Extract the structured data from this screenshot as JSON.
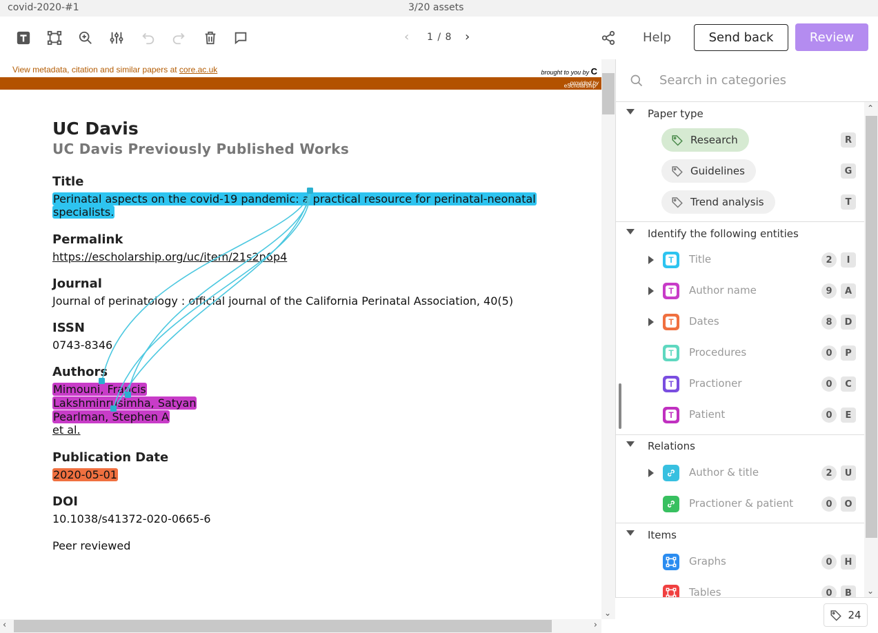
{
  "topbar": {
    "doc_name": "covid-2020-#1",
    "assets": "3/20 assets"
  },
  "toolbar": {
    "page": "1 / 8",
    "help": "Help",
    "send_back": "Send back",
    "review": "Review",
    "review_color": "#b48cf0"
  },
  "document": {
    "core_meta_prefix": "View metadata, citation and similar papers at ",
    "core_meta_link": "core.ac.uk",
    "brought_to_you": "brought to you by",
    "brought_logo": "C",
    "provided_by_label": "provided by",
    "provided_by_text": "eScholarship - University of Ca",
    "institution": "UC Davis",
    "collection": "UC Davis Previously Published Works",
    "title_label": "Title",
    "title_line1": "Perinatal aspects on the covid-19 pandemic: a practical resource for perinatal-neonatal",
    "title_line2": "specialists.",
    "permalink_label": "Permalink",
    "permalink": "https://escholarship.org/uc/item/21s2n6p4",
    "journal_label": "Journal",
    "journal": "Journal of perinatology : official journal of the California Perinatal Association, 40(5)",
    "issn_label": "ISSN",
    "issn": "0743-8346",
    "authors_label": "Authors",
    "authors": [
      "Mimouni, Francis",
      "Lakshminrusimha, Satyan",
      "Pearlman, Stephen A"
    ],
    "et_al": "et al.",
    "pubdate_label": "Publication Date",
    "pubdate": "2020-05-01",
    "doi_label": "DOI",
    "doi": "10.1038/s41372-020-0665-6",
    "peer_reviewed": "Peer reviewed"
  },
  "panel": {
    "search_placeholder": "Search in categories",
    "paper_type": {
      "header": "Paper type",
      "items": [
        {
          "label": "Research",
          "key": "R",
          "active": true
        },
        {
          "label": "Guidelines",
          "key": "G",
          "active": false
        },
        {
          "label": "Trend analysis",
          "key": "T",
          "active": false
        }
      ]
    },
    "entities": {
      "header": "Identify the following entities",
      "items": [
        {
          "label": "Title",
          "count": "2",
          "key": "I",
          "color": "#2ec4f0"
        },
        {
          "label": "Author name",
          "count": "9",
          "key": "A",
          "color": "#c83cc8"
        },
        {
          "label": "Dates",
          "count": "8",
          "key": "D",
          "color": "#f07040"
        },
        {
          "label": "Procedures",
          "count": "0",
          "key": "P",
          "color": "#5fd8c0"
        },
        {
          "label": "Practioner",
          "count": "0",
          "key": "C",
          "color": "#7a4ee0"
        },
        {
          "label": "Patient",
          "count": "0",
          "key": "E",
          "color": "#c030c0"
        }
      ]
    },
    "relations": {
      "header": "Relations",
      "items": [
        {
          "label": "Author & title",
          "count": "2",
          "key": "U",
          "color": "#38c0e0"
        },
        {
          "label": "Practioner & patient",
          "count": "0",
          "key": "O",
          "color": "#38c060"
        }
      ]
    },
    "items_section": {
      "header": "Items",
      "items": [
        {
          "label": "Graphs",
          "count": "0",
          "key": "H",
          "color": "#2a8cf0"
        },
        {
          "label": "Tables",
          "count": "0",
          "key": "B",
          "color": "#f04040"
        }
      ]
    },
    "footer_count": "24"
  }
}
